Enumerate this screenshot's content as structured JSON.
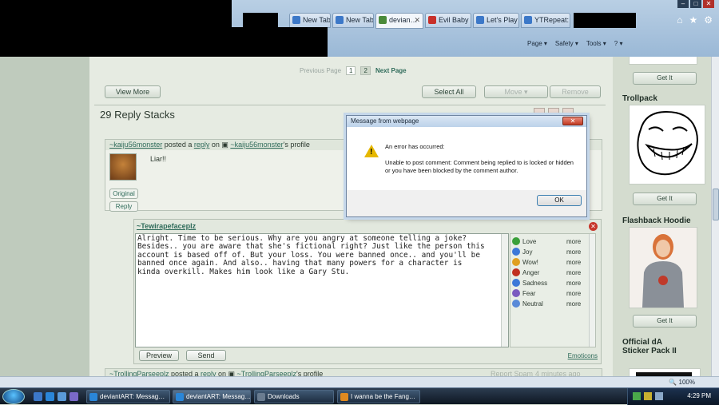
{
  "browser": {
    "tabs": [
      {
        "label": "New Tab"
      },
      {
        "label": "New Tab"
      },
      {
        "label": "devian…",
        "active": true
      },
      {
        "label": "Evil Baby …"
      },
      {
        "label": "Let's Play …"
      },
      {
        "label": "YTRepeat:…"
      }
    ],
    "command_bar": {
      "page": "Page ▾",
      "safety": "Safety ▾",
      "tools": "Tools ▾",
      "help": "? ▾"
    }
  },
  "page": {
    "pager": {
      "prev": "Previous Page",
      "pages": [
        "1",
        "2"
      ],
      "next": "Next Page"
    },
    "buttons": {
      "view_more": "View More",
      "select_all": "Select All",
      "move": "Move ▾",
      "remove": "Remove"
    },
    "stack_title": "29 Reply Stacks",
    "comment1": {
      "user": "~kaiju56monster",
      "posted": " posted a ",
      "reply": "reply",
      "on": " on ",
      "target": "~kaiju56monster",
      "suffix": "'s profile",
      "text": "Liar!!",
      "original_btn": "Original",
      "reply_btn": "Reply"
    },
    "reply_form": {
      "user": "~Tewirapefaceplz",
      "text": "Alright. Time to be serious. Why are you angry at someone telling a joke?\nBesides.. you are aware that she's fictional right? Just like the person this\naccount is based off of. But your loss. You were banned once.. and you'll be\nbanned once again. And also.. having that many powers for a character is\nkinda overkill. Makes him look like a Gary Stu.",
      "preview": "Preview",
      "send": "Send",
      "emoticons_link": "Emoticons",
      "moods": [
        {
          "label": "Love",
          "more": "more",
          "color": "#3aa03a"
        },
        {
          "label": "Joy",
          "more": "more",
          "color": "#3c78d8"
        },
        {
          "label": "Wow!",
          "more": "more",
          "color": "#e0a020"
        },
        {
          "label": "Anger",
          "more": "more",
          "color": "#c03020"
        },
        {
          "label": "Sadness",
          "more": "more",
          "color": "#3c78d8"
        },
        {
          "label": "Fear",
          "more": "more",
          "color": "#7a5ac0"
        },
        {
          "label": "Neutral",
          "more": "more",
          "color": "#5a8ad8"
        }
      ]
    },
    "comment2": {
      "user": "~TrollingParseeplz",
      "posted": " posted a ",
      "reply": "reply",
      "on": " on ",
      "target": "~TrollingParseeplz",
      "suffix": "'s profile",
      "report": "Report Spam",
      "time": "4 minutes ago"
    }
  },
  "sidebar": {
    "products": [
      {
        "get": "Get It"
      },
      {
        "title": "Trollpack",
        "get": "Get It"
      },
      {
        "title": "Flashback Hoodie",
        "get": "Get It"
      },
      {
        "title": "Official dA Sticker Pack II"
      }
    ]
  },
  "dialog": {
    "title": "Message from webpage",
    "close": "✕",
    "line1": "An error has occurred:",
    "line2": "Unable to post comment: Comment being replied to is locked or hidden or you have been blocked by the comment author.",
    "ok": "OK"
  },
  "status": {
    "zoom": "🔍 100%"
  },
  "taskbar": {
    "items": [
      {
        "label": "deviantART: Messag…"
      },
      {
        "label": "deviantART: Messag…"
      },
      {
        "label": "Downloads"
      },
      {
        "label": "I wanna be the Fang…"
      }
    ],
    "clock": "4:29 PM"
  }
}
